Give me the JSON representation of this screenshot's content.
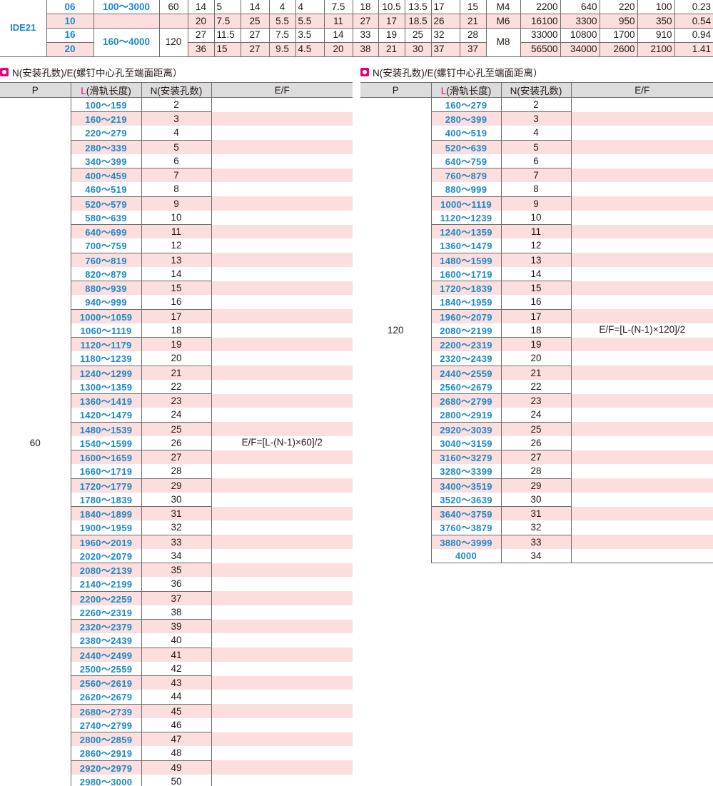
{
  "spec_table": {
    "model": "IDE21",
    "rows": [
      {
        "size": "06",
        "length": "100～3000",
        "pitch": "60",
        "vals": [
          "14",
          "5",
          "14",
          "4",
          "4",
          "7.5",
          "18",
          "10.5",
          "13.5",
          "17",
          "15"
        ],
        "screw": "M4",
        "loads": [
          "2200",
          "640",
          "220",
          "100",
          "0.23"
        ]
      },
      {
        "size": "10",
        "length": "",
        "pitch": "",
        "vals": [
          "20",
          "7.5",
          "25",
          "5.5",
          "5.5",
          "11",
          "27",
          "17",
          "18.5",
          "26",
          "21"
        ],
        "screw": "M6",
        "loads": [
          "16100",
          "3300",
          "950",
          "350",
          "0.54"
        ]
      },
      {
        "size": "16",
        "length": "160～4000",
        "pitch": "120",
        "vals": [
          "27",
          "11.5",
          "27",
          "7.5",
          "3.5",
          "14",
          "33",
          "19",
          "25",
          "32",
          "28"
        ],
        "screw": "M8",
        "loads": [
          "33000",
          "10800",
          "1700",
          "910",
          "0.94"
        ]
      },
      {
        "size": "20",
        "length": "",
        "pitch": "",
        "vals": [
          "36",
          "15",
          "27",
          "9.5",
          "4.5",
          "20",
          "38",
          "21",
          "30",
          "37",
          "37"
        ],
        "screw": "",
        "loads": [
          "56500",
          "34000",
          "2600",
          "2100",
          "1.41"
        ]
      }
    ]
  },
  "left_section": {
    "title": "N(安装孔数)/E(螺钉中心孔至端面距离）",
    "headers": {
      "p": "P",
      "l_mark": "L",
      "l_rest": "(滑轨长度)",
      "n": "N(安装孔数)",
      "ef": "E/F"
    },
    "p": "60",
    "formula": "E/F=[L-(N-1)×60]/2",
    "rows": [
      {
        "range": "100～159",
        "n": "2"
      },
      {
        "range": "160～219",
        "n": "3"
      },
      {
        "range": "220～279",
        "n": "4"
      },
      {
        "range": "280～339",
        "n": "5"
      },
      {
        "range": "340～399",
        "n": "6"
      },
      {
        "range": "400～459",
        "n": "7"
      },
      {
        "range": "460～519",
        "n": "8"
      },
      {
        "range": "520～579",
        "n": "9"
      },
      {
        "range": "580～639",
        "n": "10"
      },
      {
        "range": "640～699",
        "n": "11"
      },
      {
        "range": "700～759",
        "n": "12"
      },
      {
        "range": "760～819",
        "n": "13"
      },
      {
        "range": "820～879",
        "n": "14"
      },
      {
        "range": "880～939",
        "n": "15"
      },
      {
        "range": "940～999",
        "n": "16"
      },
      {
        "range": "1000～1059",
        "n": "17"
      },
      {
        "range": "1060～1119",
        "n": "18"
      },
      {
        "range": "1120～1179",
        "n": "19"
      },
      {
        "range": "1180～1239",
        "n": "20"
      },
      {
        "range": "1240～1299",
        "n": "21"
      },
      {
        "range": "1300～1359",
        "n": "22"
      },
      {
        "range": "1360～1419",
        "n": "23"
      },
      {
        "range": "1420～1479",
        "n": "24"
      },
      {
        "range": "1480～1539",
        "n": "25"
      },
      {
        "range": "1540～1599",
        "n": "26"
      },
      {
        "range": "1600～1659",
        "n": "27"
      },
      {
        "range": "1660～1719",
        "n": "28"
      },
      {
        "range": "1720～1779",
        "n": "29"
      },
      {
        "range": "1780～1839",
        "n": "30"
      },
      {
        "range": "1840～1899",
        "n": "31"
      },
      {
        "range": "1900～1959",
        "n": "32"
      },
      {
        "range": "1960～2019",
        "n": "33"
      },
      {
        "range": "2020～2079",
        "n": "34"
      },
      {
        "range": "2080～2139",
        "n": "35"
      },
      {
        "range": "2140～2199",
        "n": "36"
      },
      {
        "range": "2200～2259",
        "n": "37"
      },
      {
        "range": "2260～2319",
        "n": "38"
      },
      {
        "range": "2320～2379",
        "n": "39"
      },
      {
        "range": "2380～2439",
        "n": "40"
      },
      {
        "range": "2440～2499",
        "n": "41"
      },
      {
        "range": "2500～2559",
        "n": "42"
      },
      {
        "range": "2560～2619",
        "n": "43"
      },
      {
        "range": "2620～2679",
        "n": "44"
      },
      {
        "range": "2680～2739",
        "n": "45"
      },
      {
        "range": "2740～2799",
        "n": "46"
      },
      {
        "range": "2800～2859",
        "n": "47"
      },
      {
        "range": "2860～2919",
        "n": "48"
      },
      {
        "range": "2920～2979",
        "n": "49"
      },
      {
        "range": "2980～3000",
        "n": "50"
      }
    ]
  },
  "right_section": {
    "title": "N(安装孔数)/E(螺钉中心孔至端面距离）",
    "headers": {
      "p": "P",
      "l_mark": "L",
      "l_rest": "(滑轨长度)",
      "n": "N(安装孔数)",
      "ef": "E/F"
    },
    "p": "120",
    "formula": "E/F=[L-(N-1)×120]/2",
    "rows": [
      {
        "range": "160～279",
        "n": "2"
      },
      {
        "range": "280～399",
        "n": "3"
      },
      {
        "range": "400～519",
        "n": "4"
      },
      {
        "range": "520～639",
        "n": "5"
      },
      {
        "range": "640～759",
        "n": "6"
      },
      {
        "range": "760～879",
        "n": "7"
      },
      {
        "range": "880～999",
        "n": "8"
      },
      {
        "range": "1000～1119",
        "n": "9"
      },
      {
        "range": "1120～1239",
        "n": "10"
      },
      {
        "range": "1240～1359",
        "n": "11"
      },
      {
        "range": "1360～1479",
        "n": "12"
      },
      {
        "range": "1480～1599",
        "n": "13"
      },
      {
        "range": "1600～1719",
        "n": "14"
      },
      {
        "range": "1720～1839",
        "n": "15"
      },
      {
        "range": "1840～1959",
        "n": "16"
      },
      {
        "range": "1960～2079",
        "n": "17"
      },
      {
        "range": "2080～2199",
        "n": "18"
      },
      {
        "range": "2200～2319",
        "n": "19"
      },
      {
        "range": "2320～2439",
        "n": "20"
      },
      {
        "range": "2440～2559",
        "n": "21"
      },
      {
        "range": "2560～2679",
        "n": "22"
      },
      {
        "range": "2680～2799",
        "n": "23"
      },
      {
        "range": "2800～2919",
        "n": "24"
      },
      {
        "range": "2920～3039",
        "n": "25"
      },
      {
        "range": "3040～3159",
        "n": "26"
      },
      {
        "range": "3160～3279",
        "n": "27"
      },
      {
        "range": "3280～3399",
        "n": "28"
      },
      {
        "range": "3400～3519",
        "n": "29"
      },
      {
        "range": "3520～3639",
        "n": "30"
      },
      {
        "range": "3640～3759",
        "n": "31"
      },
      {
        "range": "3760～3879",
        "n": "32"
      },
      {
        "range": "3880～3999",
        "n": "33"
      },
      {
        "range": "4000",
        "n": "34"
      }
    ]
  },
  "colors": {
    "accent_blue": "#1b89c9",
    "pink_row": "#fbdedd",
    "header_gray": "#dcdcdd",
    "icon_magenta": "#e4007f"
  }
}
